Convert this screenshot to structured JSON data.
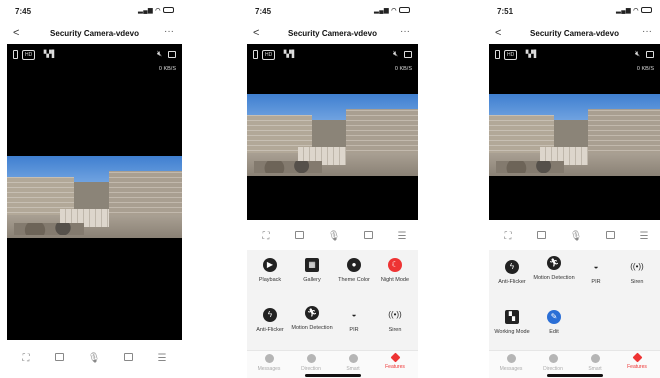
{
  "screens": [
    {
      "status": {
        "time": "7:45"
      },
      "nav": {
        "back": "<",
        "title": "Security Camera-vdevo",
        "more": "···"
      },
      "video": {
        "hd": "HD",
        "speed": "0 KB/S"
      }
    },
    {
      "status": {
        "time": "7:45"
      },
      "nav": {
        "back": "<",
        "title": "Security Camera-vdevo",
        "more": "···"
      },
      "video": {
        "hd": "HD",
        "speed": "0 KB/S"
      },
      "features": [
        {
          "label": "Playback",
          "icon": "play-icon"
        },
        {
          "label": "Gallery",
          "icon": "image-icon"
        },
        {
          "label": "Theme Color",
          "icon": "palette-icon"
        },
        {
          "label": "Night Mode",
          "icon": "moon-icon"
        },
        {
          "label": "Anti-Flicker",
          "icon": "flicker-icon"
        },
        {
          "label": "Motion Detection",
          "icon": "motion-icon"
        },
        {
          "label": "PIR",
          "icon": "pir-sensor-icon"
        },
        {
          "label": "Siren",
          "icon": "siren-icon"
        }
      ],
      "tabs": [
        "Messages",
        "Direction",
        "Smart",
        "Features"
      ]
    },
    {
      "status": {
        "time": "7:51"
      },
      "nav": {
        "back": "<",
        "title": "Security Camera-vdevo",
        "more": "···"
      },
      "video": {
        "hd": "HD",
        "speed": "0 KB/S"
      },
      "features": [
        {
          "label": "Anti-Flicker",
          "icon": "flicker-icon"
        },
        {
          "label": "Motion Detection",
          "icon": "motion-icon"
        },
        {
          "label": "PIR",
          "icon": "pir-sensor-icon"
        },
        {
          "label": "Siren",
          "icon": "siren-icon"
        },
        {
          "label": "Working Mode",
          "icon": "working-mode-icon"
        },
        {
          "label": "Edit",
          "icon": "edit-icon"
        }
      ],
      "tabs": [
        "Messages",
        "Direction",
        "Smart",
        "Features"
      ]
    }
  ],
  "colors": {
    "accent": "#e33333",
    "edit": "#2b6fd6",
    "video_bg": "#000000",
    "panel_bg": "#f3f3f3"
  }
}
